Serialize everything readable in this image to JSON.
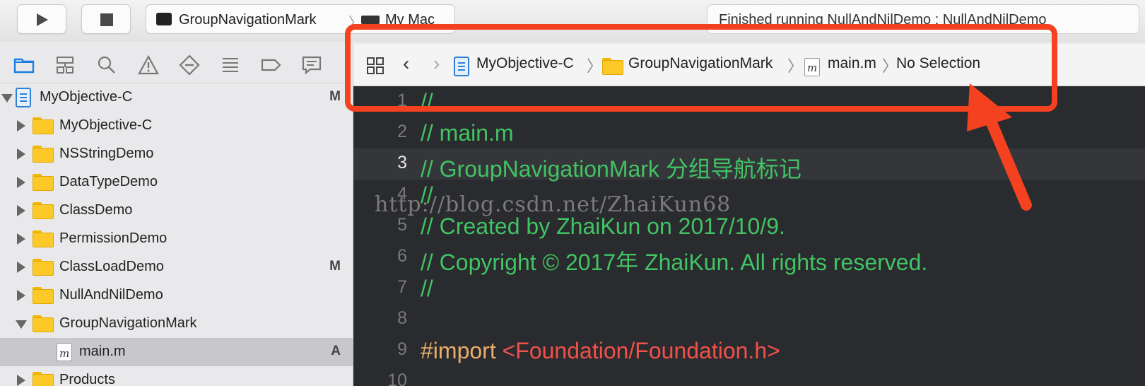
{
  "toolbar": {
    "run_button": "play-icon",
    "stop_button": "stop-icon",
    "scheme_name": "GroupNavigationMark",
    "scheme_separator": "〉",
    "destination": "My Mac",
    "activity_status": "Finished running NullAndNilDemo : NullAndNilDemo"
  },
  "navigator": {
    "tabs": [
      "folder-icon",
      "hierarchy-icon",
      "search-icon",
      "warning-icon",
      "diamond-icon",
      "list-icon",
      "tag-icon",
      "comment-icon"
    ],
    "tree": [
      {
        "label": "MyObjective-C",
        "badge": "M",
        "kind": "project",
        "expanded": true
      },
      {
        "label": "MyObjective-C",
        "badge": "",
        "kind": "folder",
        "expanded": false
      },
      {
        "label": "NSStringDemo",
        "badge": "",
        "kind": "folder",
        "expanded": false
      },
      {
        "label": "DataTypeDemo",
        "badge": "",
        "kind": "folder",
        "expanded": false
      },
      {
        "label": "ClassDemo",
        "badge": "",
        "kind": "folder",
        "expanded": false
      },
      {
        "label": "PermissionDemo",
        "badge": "",
        "kind": "folder",
        "expanded": false
      },
      {
        "label": "ClassLoadDemo",
        "badge": "M",
        "kind": "folder",
        "expanded": false
      },
      {
        "label": "NullAndNilDemo",
        "badge": "",
        "kind": "folder",
        "expanded": false
      },
      {
        "label": "GroupNavigationMark",
        "badge": "",
        "kind": "folder",
        "expanded": true
      },
      {
        "label": "main.m",
        "badge": "A",
        "kind": "file",
        "selected": true,
        "file_letter": "m"
      },
      {
        "label": "Products",
        "badge": "",
        "kind": "folder",
        "expanded": false
      }
    ]
  },
  "jumpbar": {
    "grid_icon": "grid-icon",
    "back": "‹",
    "forward": "›",
    "path": [
      "MyObjective-C",
      "GroupNavigationMark",
      "main.m",
      "No Selection"
    ],
    "separator": "〉",
    "file_letter": "m"
  },
  "editor": {
    "current_line": 3,
    "lines": [
      {
        "num": "1",
        "text": "//",
        "kind": "comment"
      },
      {
        "num": "2",
        "text": "//  main.m",
        "kind": "comment"
      },
      {
        "num": "3",
        "text": "//  GroupNavigationMark 分组导航标记",
        "kind": "comment"
      },
      {
        "num": "4",
        "text": "//",
        "kind": "comment"
      },
      {
        "num": "5",
        "text": "//  Created by ZhaiKun on 2017/10/9.",
        "kind": "comment"
      },
      {
        "num": "6",
        "text": "//  Copyright © 2017年 ZhaiKun. All rights reserved.",
        "kind": "comment"
      },
      {
        "num": "7",
        "text": "//",
        "kind": "comment"
      },
      {
        "num": "8",
        "text": "",
        "kind": "blank"
      },
      {
        "num": "9",
        "directive": "#import ",
        "text": "<Foundation/Foundation.h>",
        "kind": "import"
      },
      {
        "num": "10",
        "text": "",
        "kind": "blank"
      }
    ]
  },
  "watermark": "http://blog.csdn.net/ZhaiKun68",
  "colors": {
    "highlight": "#f4411f",
    "comment": "#41c463",
    "preprocessor": "#e8ad6c",
    "string": "#f0514a",
    "editor_bg": "#2a2b2e"
  }
}
